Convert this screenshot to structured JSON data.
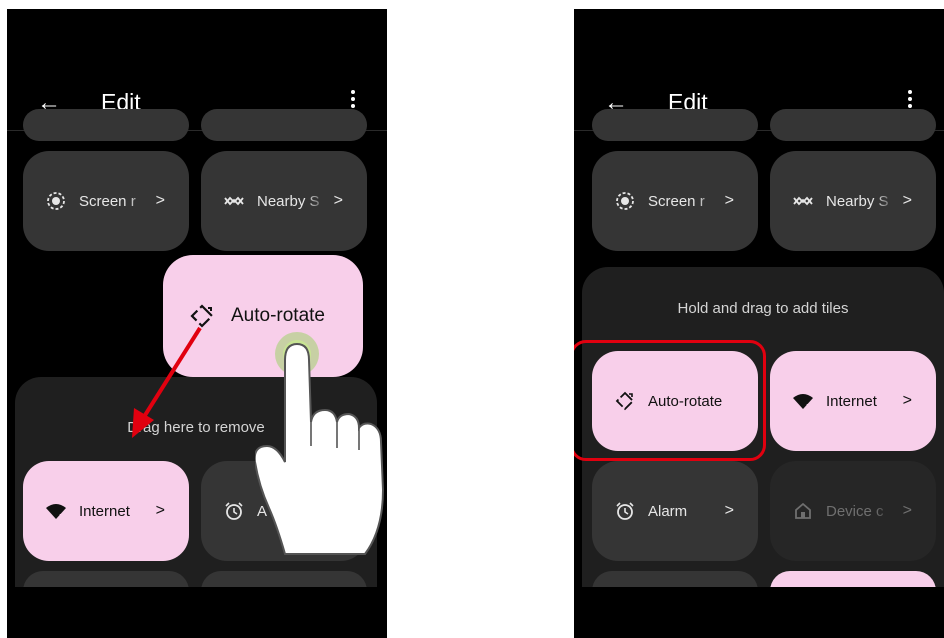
{
  "app": {
    "back_symbol": "←",
    "title": "Edit"
  },
  "left": {
    "tiles": {
      "screen": {
        "label": "Screen r",
        "chevron": ">",
        "icon": "screen-record-icon"
      },
      "nearby": {
        "label": "Nearby S",
        "chevron": ">",
        "icon": "nearby-share-icon"
      },
      "autorotate_drag": {
        "label": "Auto-rotate",
        "icon": "auto-rotate-icon"
      },
      "internet": {
        "label": "Internet",
        "chevron": ">",
        "icon": "wifi-icon"
      },
      "alarm": {
        "label": "A",
        "icon": "alarm-icon"
      }
    },
    "drop_hint": "Drag here to remove"
  },
  "right": {
    "tiles": {
      "screen": {
        "label": "Screen r",
        "chevron": ">",
        "icon": "screen-record-icon"
      },
      "nearby": {
        "label": "Nearby S",
        "chevron": ">",
        "icon": "nearby-share-icon"
      },
      "autorotate": {
        "label": "Auto-rotate",
        "icon": "auto-rotate-icon"
      },
      "internet": {
        "label": "Internet",
        "chevron": ">",
        "icon": "wifi-icon"
      },
      "alarm": {
        "label": "Alarm",
        "chevron": ">",
        "icon": "alarm-icon"
      },
      "device": {
        "label": "Device c",
        "chevron": ">",
        "icon": "home-icon"
      }
    },
    "add_hint": "Hold and drag to add tiles"
  },
  "colors": {
    "tile_active": "#f8cfea",
    "tile_inactive": "#353535",
    "annotation_red": "#e1000f"
  }
}
